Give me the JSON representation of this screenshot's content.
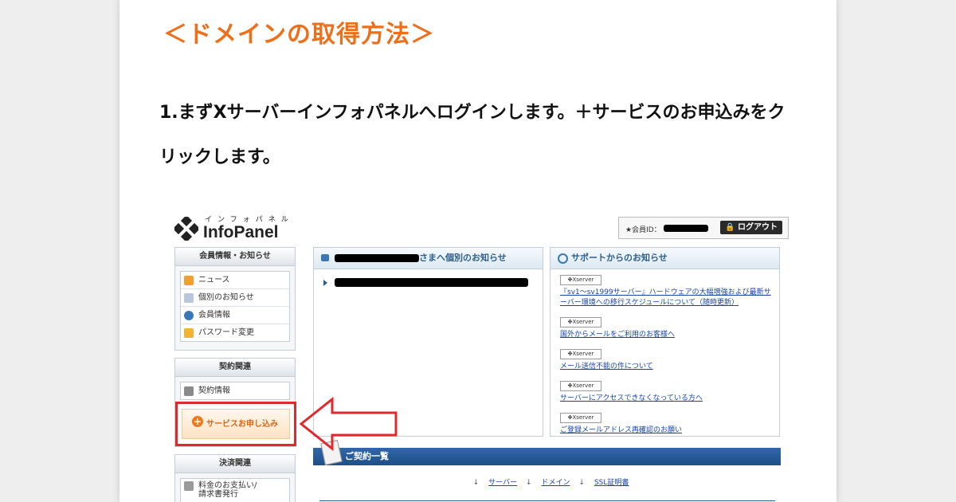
{
  "article": {
    "heading": "＜ドメインの取得方法＞",
    "step_text": "1.まずXサーバーインフォパネルへログインします。＋サービスのお申込みをクリックします。"
  },
  "logo": {
    "kana": "インフォパネル",
    "text": "InfoPanel"
  },
  "header": {
    "member_id_label": "★会員ID：",
    "logout_label": "ログアウト"
  },
  "sidebar": {
    "sections": [
      {
        "title": "会員情報・お知らせ",
        "items": [
          {
            "label": "ニュース",
            "icon": "key-icon"
          },
          {
            "label": "個別のお知らせ",
            "icon": "mail-icon"
          },
          {
            "label": "会員情報",
            "icon": "user-icon"
          },
          {
            "label": "パスワード変更",
            "icon": "lock-icon"
          }
        ]
      },
      {
        "title": "契約関連",
        "items": [
          {
            "label": "契約情報",
            "icon": "contract-icon"
          }
        ],
        "cta_label": "サービスお申し込み"
      },
      {
        "title": "決済関連",
        "items": [
          {
            "label": "料金のお支払い/\n請求書発行",
            "icon": "payment-icon"
          }
        ]
      }
    ]
  },
  "personal_notices": {
    "title_suffix": "さまへ個別のお知らせ"
  },
  "support_notices": {
    "title": "サポートからのお知らせ",
    "items": [
      {
        "badge": "Xserver",
        "text": "『sv1～sv1999サーバー』ハードウェアの大幅増強および最新サーバー環境への移行スケジュールについて（随時更新）"
      },
      {
        "badge": "Xserver",
        "text": "国外からメールをご利用のお客様へ"
      },
      {
        "badge": "Xserver",
        "text": "メール送信不能の件について"
      },
      {
        "badge": "Xserver",
        "text": "サーバーにアクセスできなくなっている方へ"
      },
      {
        "badge": "Xserver",
        "text": "ご登録メールアドレス再確認のお願い"
      }
    ]
  },
  "contracts": {
    "title": "ご契約一覧",
    "links": [
      "サーバー",
      "ドメイン",
      "SSL証明書"
    ]
  },
  "colors": {
    "heading": "#ec6f1c",
    "highlight": "#e0292d",
    "link": "#1844a6",
    "panel_title": "#2e5f8a",
    "bar": "#2f68a8"
  }
}
